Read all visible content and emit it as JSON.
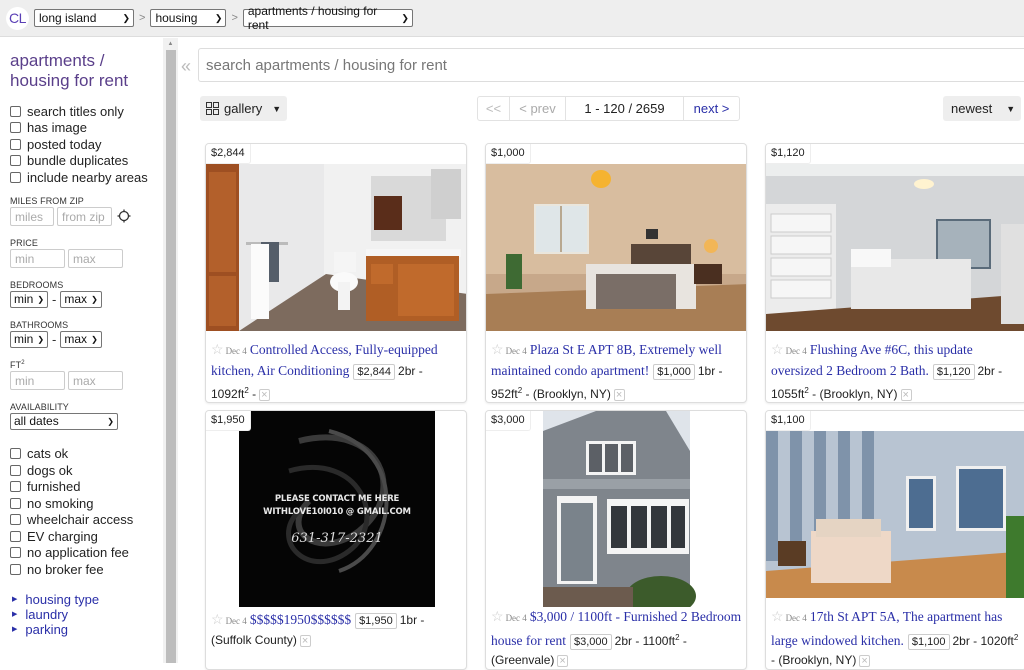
{
  "header": {
    "logo": "CL",
    "breadcrumb": [
      {
        "label": "long island"
      },
      {
        "label": "housing"
      },
      {
        "label": "apartments / housing for rent"
      }
    ],
    "separator": ">"
  },
  "sidebar": {
    "title": "apartments / housing for rent",
    "search_options": [
      {
        "label": "search titles only",
        "checked": false
      },
      {
        "label": "has image",
        "checked": false
      },
      {
        "label": "posted today",
        "checked": false
      },
      {
        "label": "bundle duplicates",
        "checked": false
      },
      {
        "label": "include nearby areas",
        "checked": false
      }
    ],
    "miles_from_zip": {
      "label": "MILES FROM ZIP",
      "miles_placeholder": "miles",
      "zip_placeholder": "from zip"
    },
    "price": {
      "label": "PRICE",
      "min_placeholder": "min",
      "max_placeholder": "max"
    },
    "bedrooms": {
      "label": "BEDROOMS",
      "min": "min",
      "max": "max"
    },
    "bathrooms": {
      "label": "BATHROOMS",
      "min": "min",
      "max": "max"
    },
    "sqft": {
      "label": "FT",
      "label_sup": "2",
      "min_placeholder": "min",
      "max_placeholder": "max"
    },
    "availability": {
      "label": "AVAILABILITY",
      "value": "all dates"
    },
    "range_dash": "-",
    "amenities": [
      {
        "label": "cats ok",
        "checked": false
      },
      {
        "label": "dogs ok",
        "checked": false
      },
      {
        "label": "furnished",
        "checked": false
      },
      {
        "label": "no smoking",
        "checked": false
      },
      {
        "label": "wheelchair access",
        "checked": false
      },
      {
        "label": "EV charging",
        "checked": false
      },
      {
        "label": "no application fee",
        "checked": false
      },
      {
        "label": "no broker fee",
        "checked": false
      }
    ],
    "expandable_links": [
      {
        "label": "housing type"
      },
      {
        "label": "laundry"
      },
      {
        "label": "parking"
      }
    ]
  },
  "main": {
    "collapse_icon": "«",
    "search_placeholder": "search apartments / housing for rent",
    "view_mode": "gallery",
    "pager": {
      "first": "<<",
      "prev": "< prev",
      "range": "1 - 120 / 2659",
      "next": "next >"
    },
    "sort": "newest",
    "listings": [
      {
        "price_tag": "$2,844",
        "date": "Dec 4",
        "title": "Controlled Access, Fully-equipped kitchen, Air Conditioning",
        "price": "$2,844",
        "details": "2br - 1092ft",
        "details_sup": "2",
        "location": " -"
      },
      {
        "price_tag": "$1,000",
        "date": "Dec 4",
        "title": "Plaza St E APT 8B, Extremely well maintained condo apartment!",
        "price": "$1,000",
        "details": "1br - 952ft",
        "details_sup": "2",
        "location": " - (Brooklyn, NY)"
      },
      {
        "price_tag": "$1,120",
        "date": "Dec 4",
        "title": "Flushing Ave #6C, this update oversized 2 Bedroom 2 Bath.",
        "price": "$1,120",
        "details": "2br - 1055ft",
        "details_sup": "2",
        "location": " - (Brooklyn, NY)"
      },
      {
        "price_tag": "$1,950",
        "date": "Dec 4",
        "title": "$$$$$1950$$$$$$",
        "price": "$1,950",
        "details": "1br -",
        "details_sup": "",
        "location": " (Suffolk County)",
        "image_text": [
          "PLEASE CONTACT ME HERE",
          "WITHLOVE10I010 @ GMAIL.COM",
          "631-317-2321"
        ]
      },
      {
        "price_tag": "$3,000",
        "date": "Dec 4",
        "title": "$3,000 / 1100ft - Furnished 2 Bedroom house for rent",
        "price": "$3,000",
        "details": "2br - 1100ft",
        "details_sup": "2",
        "location": " - (Greenvale)"
      },
      {
        "price_tag": "$1,100",
        "date": "Dec 4",
        "title": "17th St APT 5A, The apartment has large windowed kitchen.",
        "price": "$1,100",
        "details": "2br - 1020ft",
        "details_sup": "2",
        "location": " - (Brooklyn, NY)"
      }
    ]
  },
  "colors": {
    "link": "#2a2fa8",
    "title_purple": "#5a3f8a",
    "header_bg": "#eeeeee"
  }
}
